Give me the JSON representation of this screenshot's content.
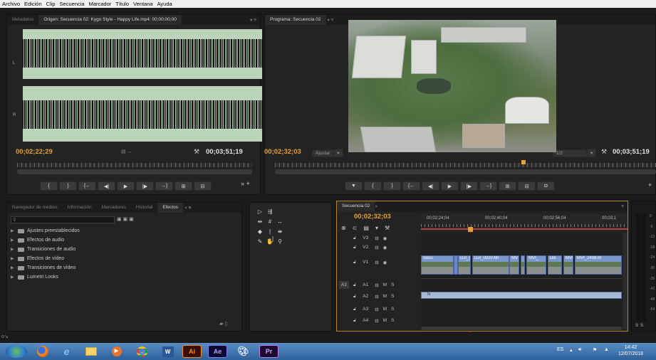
{
  "menu": [
    "Archivo",
    "Edición",
    "Clip",
    "Secuencia",
    "Marcador",
    "Título",
    "Ventana",
    "Ayuda"
  ],
  "source": {
    "tab_metadata": "Metadatos",
    "tab_source": "Origen: Secuencia 02: Kygo Style - Happy Life.mp4: 00;00;00;00",
    "ch_left": "L",
    "ch_right": "R",
    "timecode_current": "00;02;22;29",
    "timecode_duration": "00;03;51;19"
  },
  "program": {
    "tab": "Programa: Secuencia 02",
    "timecode_current": "00;02;32;03",
    "fit": "Ajustar",
    "resolution": "1/2",
    "timecode_duration": "00;03;51;19"
  },
  "effects": {
    "tabs": [
      "Navegador de medios",
      "Información",
      "Marcadores",
      "Historial",
      "Efectos"
    ],
    "items": [
      "Ajustes preestablecidos",
      "Efectos de audio",
      "Transiciones de audio",
      "Efectos de vídeo",
      "Transiciones de vídeo",
      "Lumetri Looks"
    ]
  },
  "timeline": {
    "tab": "Secuencia 02",
    "timecode": "00;02;32;03",
    "ruler_labels": [
      "00;02;24;04",
      "00;02;40;04",
      "00;02;56;04",
      "00;03;1"
    ],
    "video_tracks": [
      "V3",
      "V2",
      "V1"
    ],
    "audio_tracks": [
      "A1",
      "A2",
      "A3",
      "A4"
    ],
    "source_patch": "A1",
    "mute": "M",
    "solo": "S",
    "clips": [
      "Secu",
      "DJI_(",
      "DJI_0020.MI",
      "MV",
      "MVI_",
      "Dis",
      "MVI",
      "MVI_2408.M"
    ]
  },
  "vu_labels": [
    "0",
    "-6",
    "-12",
    "-18",
    "-24",
    "-30",
    "-36",
    "-42",
    "-48",
    "-54"
  ],
  "vu_buttons": [
    "S",
    "S"
  ],
  "taskbar": {
    "apps": [
      "Ai",
      "Ae",
      "Pr"
    ],
    "lang": "ES",
    "time": "14:42",
    "date": "12/07/2018"
  }
}
